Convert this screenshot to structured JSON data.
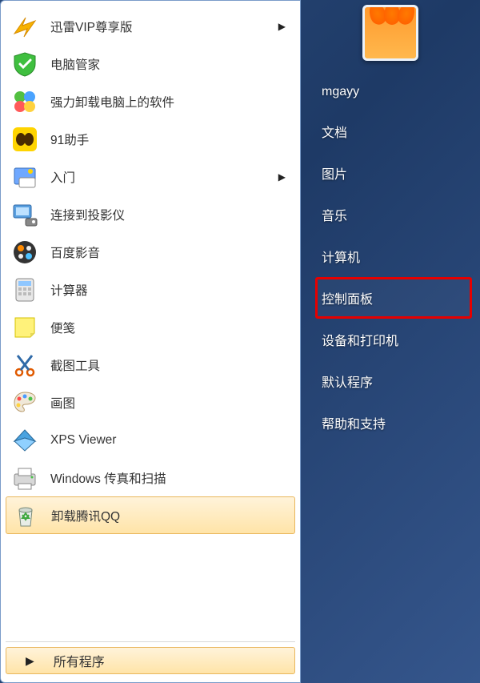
{
  "programs": [
    {
      "label": "迅雷VIP尊享版",
      "hasSubmenu": true
    },
    {
      "label": "电脑管家",
      "hasSubmenu": false
    },
    {
      "label": "强力卸载电脑上的软件",
      "hasSubmenu": false
    },
    {
      "label": "91助手",
      "hasSubmenu": false
    },
    {
      "label": "入门",
      "hasSubmenu": true
    },
    {
      "label": "连接到投影仪",
      "hasSubmenu": false
    },
    {
      "label": "百度影音",
      "hasSubmenu": false
    },
    {
      "label": "计算器",
      "hasSubmenu": false
    },
    {
      "label": "便笺",
      "hasSubmenu": false
    },
    {
      "label": "截图工具",
      "hasSubmenu": false
    },
    {
      "label": "画图",
      "hasSubmenu": false
    },
    {
      "label": "XPS Viewer",
      "hasSubmenu": false
    },
    {
      "label": "Windows 传真和扫描",
      "hasSubmenu": false
    },
    {
      "label": "卸载腾讯QQ",
      "hasSubmenu": false,
      "highlight": true
    }
  ],
  "allPrograms": {
    "label": "所有程序"
  },
  "rightItems": [
    {
      "label": "mgayy",
      "highlighted": false
    },
    {
      "label": "文档",
      "highlighted": false
    },
    {
      "label": "图片",
      "highlighted": false
    },
    {
      "label": "音乐",
      "highlighted": false
    },
    {
      "label": "计算机",
      "highlighted": false
    },
    {
      "label": "控制面板",
      "highlighted": true
    },
    {
      "label": "设备和打印机",
      "highlighted": false
    },
    {
      "label": "默认程序",
      "highlighted": false
    },
    {
      "label": "帮助和支持",
      "highlighted": false
    }
  ],
  "icons": {
    "submenuArrow": "▶"
  }
}
